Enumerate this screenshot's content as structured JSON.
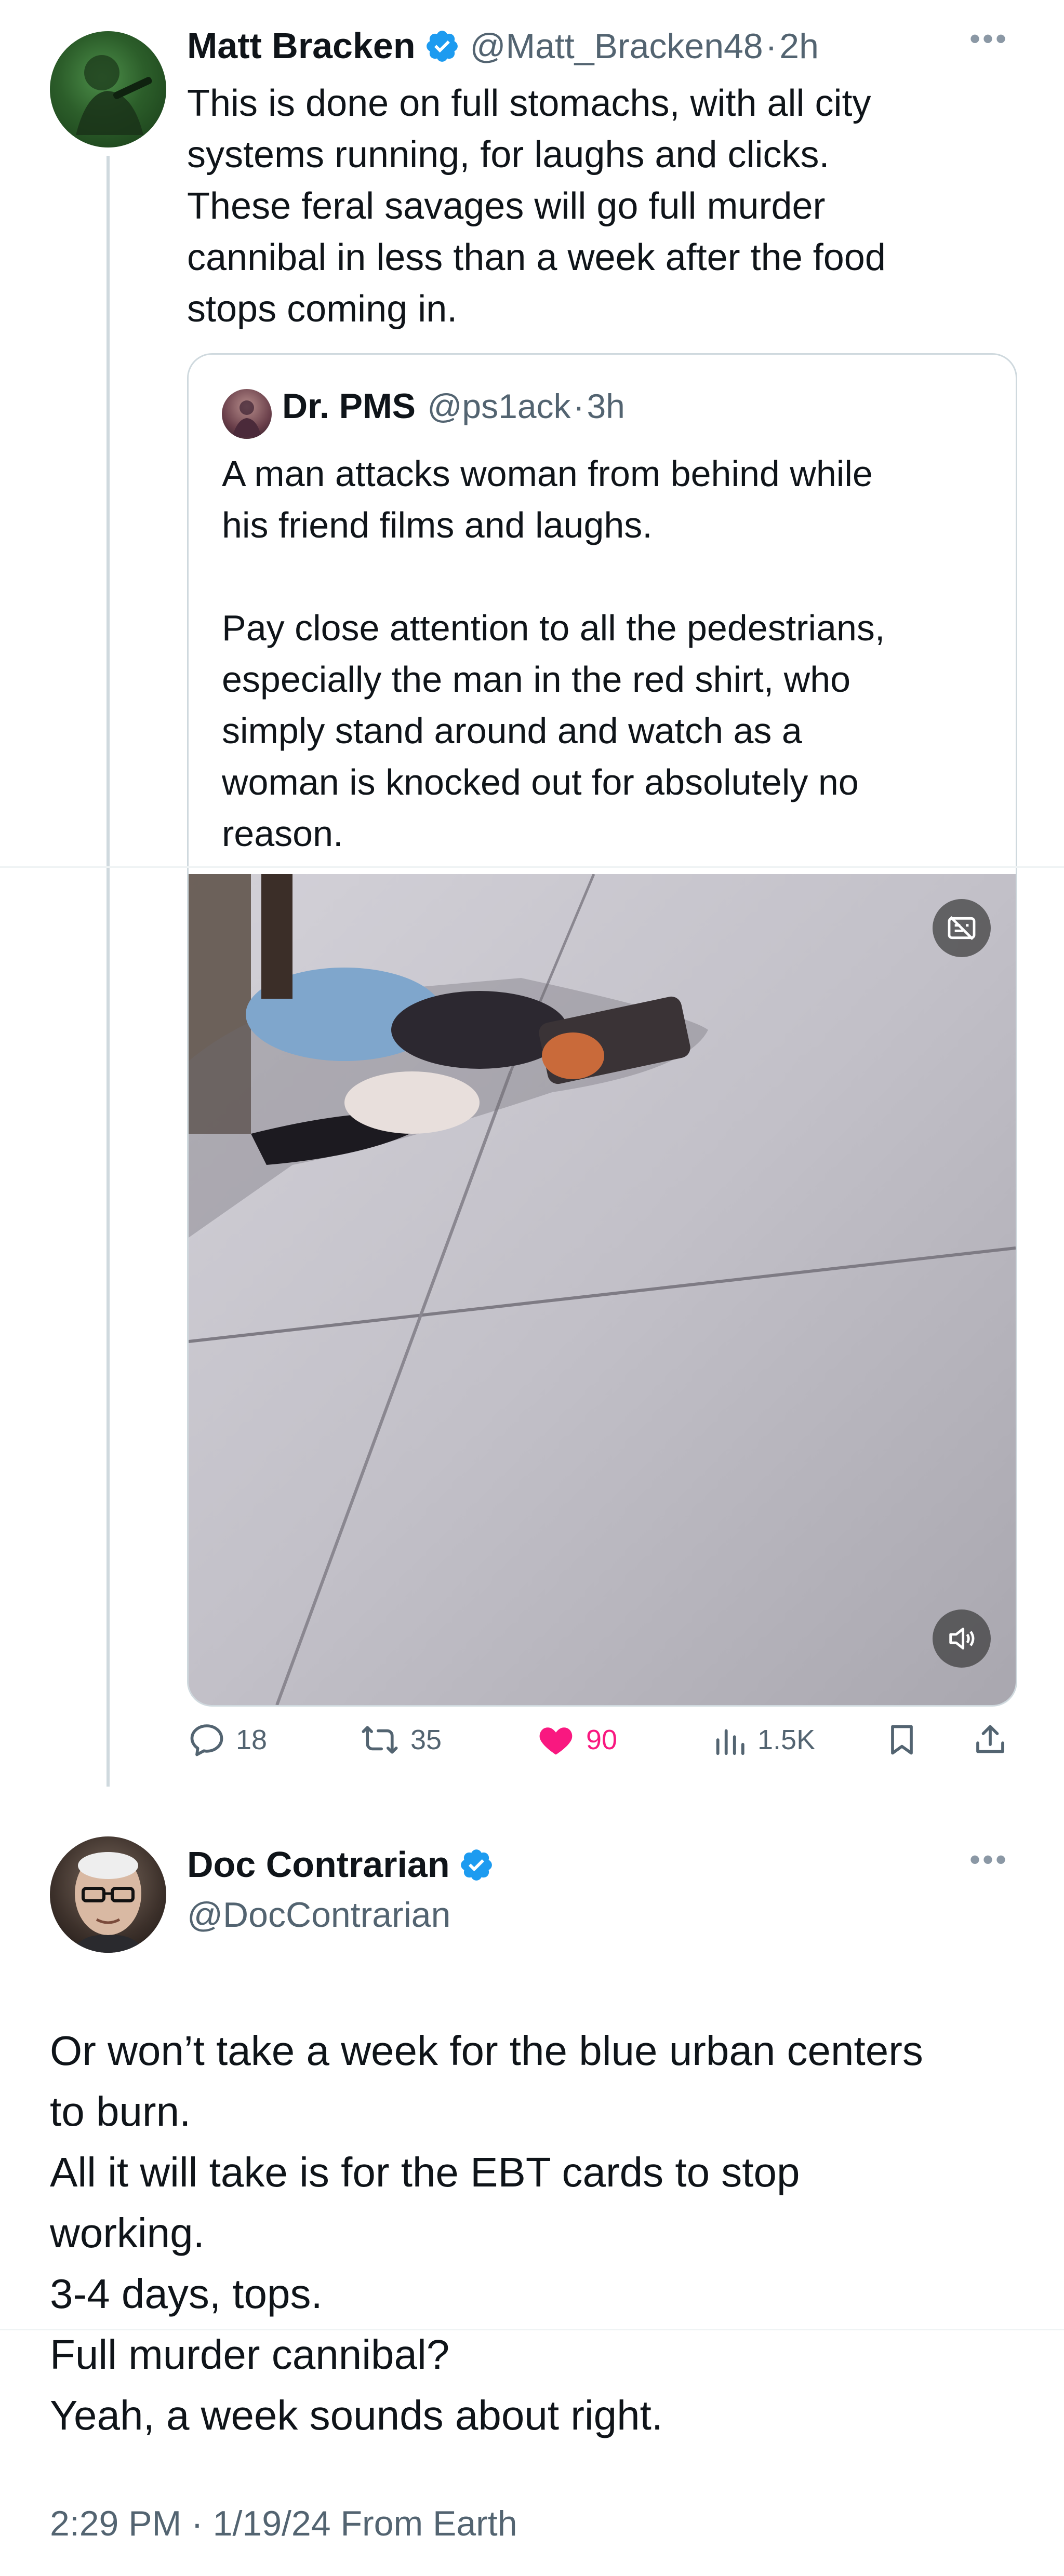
{
  "tweet1": {
    "name": "Matt Bracken",
    "handle": "@Matt_Bracken48",
    "separator": "·",
    "time": "2h",
    "text": "This is done on full stomachs, with all city\nsystems running, for laughs and clicks.\nThese feral savages will go full murder\ncannibal in less than a week after the food\nstops coming in."
  },
  "quote": {
    "name": "Dr. PMS",
    "handle": "@ps1ack",
    "separator": "·",
    "time": "3h",
    "text": "A man attacks woman from behind while\nhis friend films and laughs.\n\nPay close attention to all the pedestrians,\nespecially the man in the red shirt, who\nsimply stand around and watch as a\nwoman is knocked out for absolutely no\nreason."
  },
  "actions": {
    "replies": "18",
    "reposts": "35",
    "likes": "90",
    "views": "1.5K"
  },
  "tweet2": {
    "name": "Doc Contrarian",
    "handle": "@DocContrarian",
    "text": "Or won’t take a week for the blue urban centers\nto burn.\nAll it will take is for the EBT cards to stop\nworking.\n3-4 days, tops.\nFull murder cannibal?\nYeah, a week sounds about right.",
    "timestamp": "2:29 PM · 1/19/24 From Earth"
  },
  "colors": {
    "verified": "#1d9bf0",
    "like": "#f91880",
    "secondary_text": "#536471",
    "border": "#cfd9de"
  },
  "icons": [
    "verified-badge-icon",
    "more-icon",
    "reply-icon",
    "repost-icon",
    "heart-icon",
    "views-icon",
    "bookmark-icon",
    "share-icon",
    "captions-icon",
    "volume-icon"
  ]
}
